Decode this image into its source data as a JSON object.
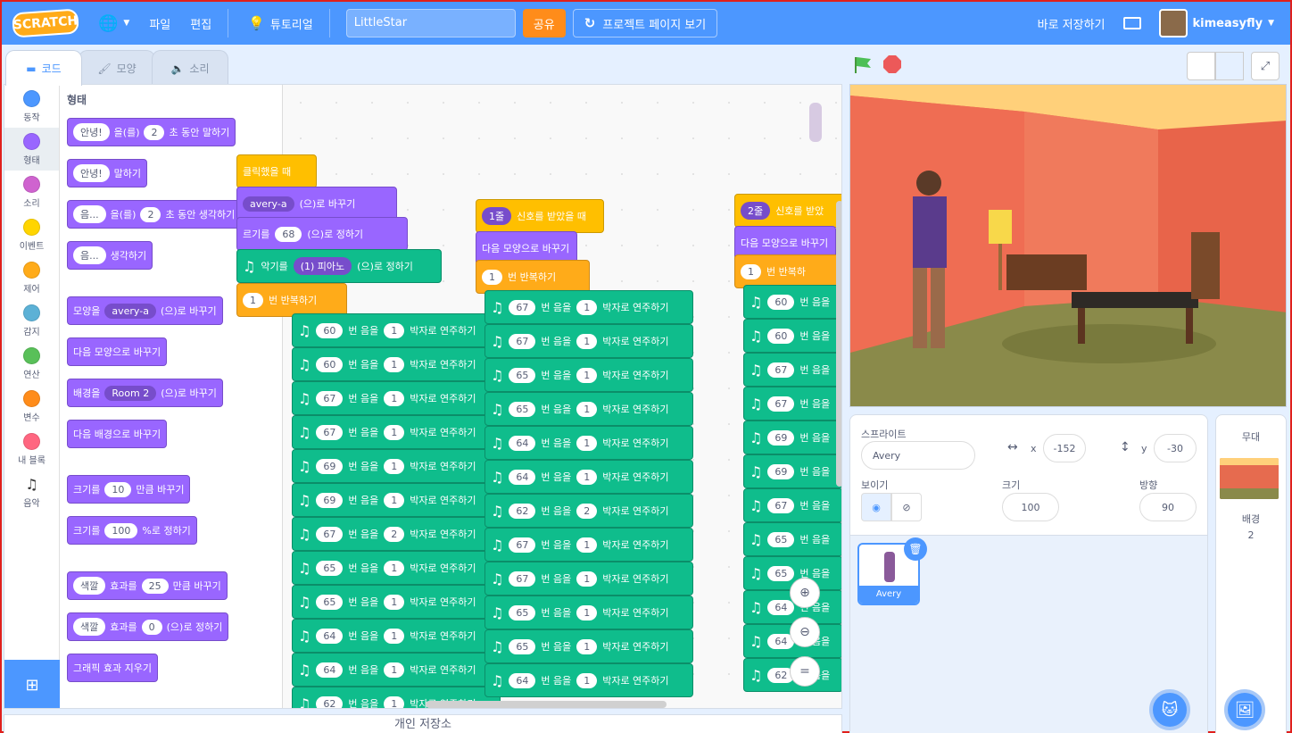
{
  "menubar": {
    "logo": "SCRATCH",
    "file": "파일",
    "edit": "편집",
    "tutorials": "튜토리얼",
    "project_title": "LittleStar",
    "share": "공유",
    "see_project_page": "프로젝트 페이지 보기",
    "save_now": "바로 저장하기",
    "username": "kimeasyfly"
  },
  "tabs": {
    "code": "코드",
    "costumes": "모양",
    "sounds": "소리"
  },
  "categories": [
    {
      "label": "동작",
      "color": "#4c97ff"
    },
    {
      "label": "형태",
      "color": "#9966ff"
    },
    {
      "label": "소리",
      "color": "#cf63cf"
    },
    {
      "label": "이벤트",
      "color": "#ffd500"
    },
    {
      "label": "제어",
      "color": "#ffab19"
    },
    {
      "label": "감지",
      "color": "#5cb1d6"
    },
    {
      "label": "연산",
      "color": "#59c059"
    },
    {
      "label": "변수",
      "color": "#ff8c1a"
    },
    {
      "label": "내 블록",
      "color": "#ff6680"
    },
    {
      "label": "음악",
      "color": "icon"
    }
  ],
  "palette": {
    "title": "형태",
    "say_for": {
      "text": "안녕!",
      "mid": "을(를)",
      "secs": "2",
      "end": "초 동안 말하기"
    },
    "say": {
      "text": "안녕!",
      "end": "말하기"
    },
    "think_for": {
      "text": "음...",
      "mid": "을(를)",
      "secs": "2",
      "end": "초 동안 생각하기"
    },
    "think": {
      "text": "음...",
      "end": "생각하기"
    },
    "switch_costume": {
      "pre": "모양을",
      "value": "avery-a",
      "end": "(으)로 바꾸기"
    },
    "next_costume": "다음 모양으로 바꾸기",
    "switch_backdrop": {
      "pre": "배경을",
      "value": "Room 2",
      "end": "(으)로 바꾸기"
    },
    "next_backdrop": "다음 배경으로 바꾸기",
    "change_size": {
      "pre": "크기를",
      "value": "10",
      "end": "만큼 바꾸기"
    },
    "set_size": {
      "pre": "크기를",
      "value": "100",
      "end": "%로 정하기"
    },
    "change_effect": {
      "effect": "색깔",
      "mid": "효과를",
      "value": "25",
      "end": "만큼 바꾸기"
    },
    "set_effect": {
      "effect": "색깔",
      "mid": "효과를",
      "value": "0",
      "end": "(으)로 정하기"
    },
    "clear_effects": "그래픽 효과 지우기"
  },
  "script1": {
    "hat": "클릭했을 때",
    "costume_val": "avery-a",
    "costume_end": "(으)로 바꾸기",
    "size_pre": "르기를",
    "size_val": "68",
    "size_end": "(으)로 정하기",
    "inst_pre": "악기를",
    "inst_val": "(1) 피아노",
    "inst_end": "(으)로 정하기",
    "repeat_val": "1",
    "repeat_end": "번 반복하기",
    "notes": [
      "60",
      "60",
      "67",
      "67",
      "69",
      "69",
      "67",
      "65",
      "65",
      "64",
      "64",
      "62"
    ],
    "beats": [
      "1",
      "1",
      "1",
      "1",
      "1",
      "1",
      "2",
      "1",
      "1",
      "1",
      "1",
      "1"
    ]
  },
  "script2": {
    "hat_val": "1줄",
    "hat_end": "신호를 받았을 때",
    "next_costume": "다음 모양으로 바꾸기",
    "repeat_val": "1",
    "repeat_end": "번 반복하기",
    "notes": [
      "67",
      "67",
      "65",
      "65",
      "64",
      "64",
      "62",
      "67",
      "67",
      "65",
      "65",
      "64"
    ],
    "beats": [
      "1",
      "1",
      "1",
      "1",
      "1",
      "1",
      "2",
      "1",
      "1",
      "1",
      "1",
      "1"
    ]
  },
  "script3": {
    "hat_val": "2줄",
    "hat_end": "신호를 받았",
    "next_costume": "다음 모양으로 바꾸기",
    "repeat_val": "1",
    "repeat_end": "번 반복하",
    "notes": [
      "60",
      "60",
      "67",
      "67",
      "69",
      "69",
      "67",
      "65",
      "65",
      "64",
      "64",
      "62"
    ]
  },
  "note_words": {
    "pre": "번 음을",
    "mid": "박자로 연주하기",
    "mid_short": "번 음을"
  },
  "sprite_panel": {
    "sprite_label": "스프라이트",
    "sprite_name": "Avery",
    "x_label": "x",
    "x_value": "-152",
    "y_label": "y",
    "y_value": "-30",
    "show_label": "보이기",
    "size_label": "크기",
    "size_value": "100",
    "direction_label": "방향",
    "direction_value": "90",
    "sprite_card_name": "Avery"
  },
  "stage_panel": {
    "title": "무대",
    "backdrops_label": "배경",
    "backdrops_count": "2"
  },
  "backpack": "개인 저장소"
}
